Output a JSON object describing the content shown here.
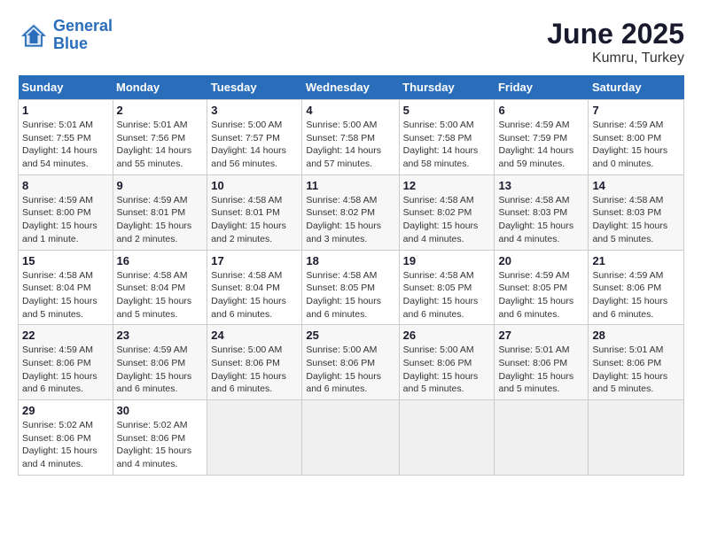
{
  "header": {
    "logo_line1": "General",
    "logo_line2": "Blue",
    "title": "June 2025",
    "subtitle": "Kumru, Turkey"
  },
  "calendar": {
    "days_of_week": [
      "Sunday",
      "Monday",
      "Tuesday",
      "Wednesday",
      "Thursday",
      "Friday",
      "Saturday"
    ],
    "weeks": [
      [
        {
          "day": "1",
          "info": "Sunrise: 5:01 AM\nSunset: 7:55 PM\nDaylight: 14 hours\nand 54 minutes."
        },
        {
          "day": "2",
          "info": "Sunrise: 5:01 AM\nSunset: 7:56 PM\nDaylight: 14 hours\nand 55 minutes."
        },
        {
          "day": "3",
          "info": "Sunrise: 5:00 AM\nSunset: 7:57 PM\nDaylight: 14 hours\nand 56 minutes."
        },
        {
          "day": "4",
          "info": "Sunrise: 5:00 AM\nSunset: 7:58 PM\nDaylight: 14 hours\nand 57 minutes."
        },
        {
          "day": "5",
          "info": "Sunrise: 5:00 AM\nSunset: 7:58 PM\nDaylight: 14 hours\nand 58 minutes."
        },
        {
          "day": "6",
          "info": "Sunrise: 4:59 AM\nSunset: 7:59 PM\nDaylight: 14 hours\nand 59 minutes."
        },
        {
          "day": "7",
          "info": "Sunrise: 4:59 AM\nSunset: 8:00 PM\nDaylight: 15 hours\nand 0 minutes."
        }
      ],
      [
        {
          "day": "8",
          "info": "Sunrise: 4:59 AM\nSunset: 8:00 PM\nDaylight: 15 hours\nand 1 minute."
        },
        {
          "day": "9",
          "info": "Sunrise: 4:59 AM\nSunset: 8:01 PM\nDaylight: 15 hours\nand 2 minutes."
        },
        {
          "day": "10",
          "info": "Sunrise: 4:58 AM\nSunset: 8:01 PM\nDaylight: 15 hours\nand 2 minutes."
        },
        {
          "day": "11",
          "info": "Sunrise: 4:58 AM\nSunset: 8:02 PM\nDaylight: 15 hours\nand 3 minutes."
        },
        {
          "day": "12",
          "info": "Sunrise: 4:58 AM\nSunset: 8:02 PM\nDaylight: 15 hours\nand 4 minutes."
        },
        {
          "day": "13",
          "info": "Sunrise: 4:58 AM\nSunset: 8:03 PM\nDaylight: 15 hours\nand 4 minutes."
        },
        {
          "day": "14",
          "info": "Sunrise: 4:58 AM\nSunset: 8:03 PM\nDaylight: 15 hours\nand 5 minutes."
        }
      ],
      [
        {
          "day": "15",
          "info": "Sunrise: 4:58 AM\nSunset: 8:04 PM\nDaylight: 15 hours\nand 5 minutes."
        },
        {
          "day": "16",
          "info": "Sunrise: 4:58 AM\nSunset: 8:04 PM\nDaylight: 15 hours\nand 5 minutes."
        },
        {
          "day": "17",
          "info": "Sunrise: 4:58 AM\nSunset: 8:04 PM\nDaylight: 15 hours\nand 6 minutes."
        },
        {
          "day": "18",
          "info": "Sunrise: 4:58 AM\nSunset: 8:05 PM\nDaylight: 15 hours\nand 6 minutes."
        },
        {
          "day": "19",
          "info": "Sunrise: 4:58 AM\nSunset: 8:05 PM\nDaylight: 15 hours\nand 6 minutes."
        },
        {
          "day": "20",
          "info": "Sunrise: 4:59 AM\nSunset: 8:05 PM\nDaylight: 15 hours\nand 6 minutes."
        },
        {
          "day": "21",
          "info": "Sunrise: 4:59 AM\nSunset: 8:06 PM\nDaylight: 15 hours\nand 6 minutes."
        }
      ],
      [
        {
          "day": "22",
          "info": "Sunrise: 4:59 AM\nSunset: 8:06 PM\nDaylight: 15 hours\nand 6 minutes."
        },
        {
          "day": "23",
          "info": "Sunrise: 4:59 AM\nSunset: 8:06 PM\nDaylight: 15 hours\nand 6 minutes."
        },
        {
          "day": "24",
          "info": "Sunrise: 5:00 AM\nSunset: 8:06 PM\nDaylight: 15 hours\nand 6 minutes."
        },
        {
          "day": "25",
          "info": "Sunrise: 5:00 AM\nSunset: 8:06 PM\nDaylight: 15 hours\nand 6 minutes."
        },
        {
          "day": "26",
          "info": "Sunrise: 5:00 AM\nSunset: 8:06 PM\nDaylight: 15 hours\nand 5 minutes."
        },
        {
          "day": "27",
          "info": "Sunrise: 5:01 AM\nSunset: 8:06 PM\nDaylight: 15 hours\nand 5 minutes."
        },
        {
          "day": "28",
          "info": "Sunrise: 5:01 AM\nSunset: 8:06 PM\nDaylight: 15 hours\nand 5 minutes."
        }
      ],
      [
        {
          "day": "29",
          "info": "Sunrise: 5:02 AM\nSunset: 8:06 PM\nDaylight: 15 hours\nand 4 minutes."
        },
        {
          "day": "30",
          "info": "Sunrise: 5:02 AM\nSunset: 8:06 PM\nDaylight: 15 hours\nand 4 minutes."
        },
        {
          "day": "",
          "info": ""
        },
        {
          "day": "",
          "info": ""
        },
        {
          "day": "",
          "info": ""
        },
        {
          "day": "",
          "info": ""
        },
        {
          "day": "",
          "info": ""
        }
      ]
    ]
  }
}
